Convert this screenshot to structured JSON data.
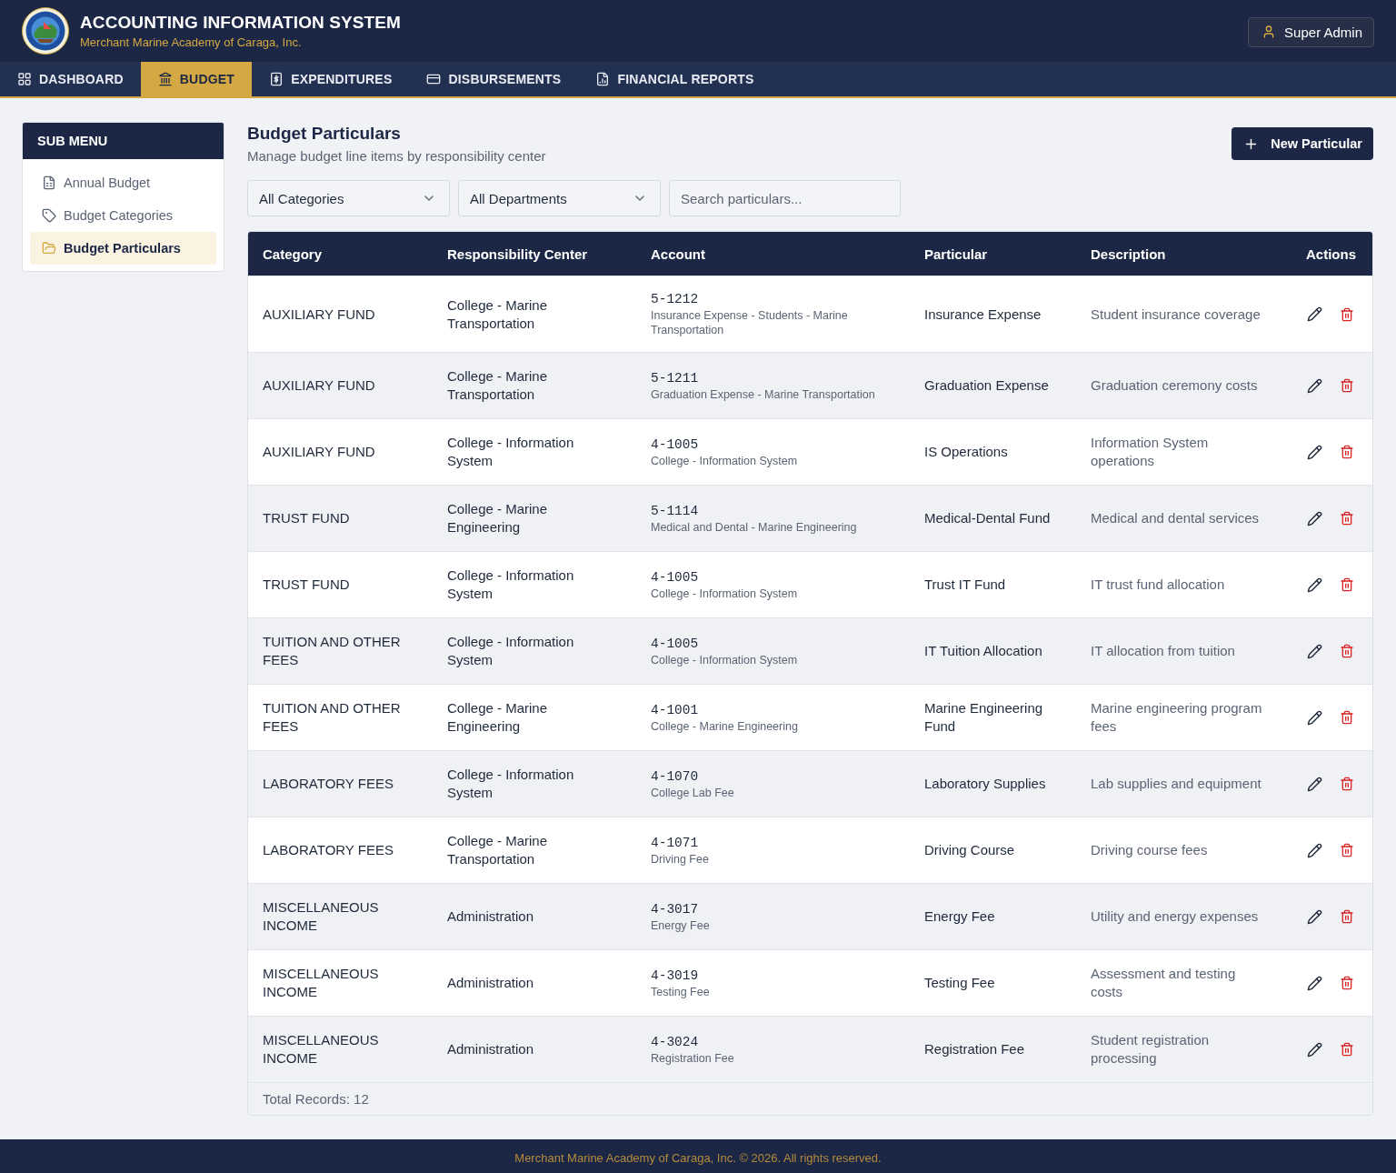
{
  "header": {
    "title": "ACCOUNTING INFORMATION SYSTEM",
    "subtitle": "Merchant Marine Academy of Caraga, Inc.",
    "user_button": "Super Admin"
  },
  "nav_tabs": [
    {
      "label": "DASHBOARD",
      "selected": false
    },
    {
      "label": "BUDGET",
      "selected": true
    },
    {
      "label": "EXPENDITURES",
      "selected": false
    },
    {
      "label": "DISBURSEMENTS",
      "selected": false
    },
    {
      "label": "FINANCIAL REPORTS",
      "selected": false
    }
  ],
  "sub_menu": {
    "title": "SUB MENU",
    "items": [
      {
        "label": "Annual Budget",
        "selected": false
      },
      {
        "label": "Budget Categories",
        "selected": false
      },
      {
        "label": "Budget Particulars",
        "selected": true
      }
    ]
  },
  "page": {
    "title": "Budget Particulars",
    "subtitle": "Manage budget line items by responsibility center",
    "new_button": "New Particular"
  },
  "filters": [
    {
      "kind": "select",
      "value": "All Categories"
    },
    {
      "kind": "select",
      "value": "All Departments"
    },
    {
      "kind": "search",
      "placeholder": "Search particulars..."
    }
  ],
  "table": {
    "columns": [
      "Category",
      "Responsibility Center",
      "Account",
      "Particular",
      "Description",
      "Actions"
    ],
    "rows": [
      {
        "category": "AUXILIARY FUND",
        "responsibility_center": "College - Marine Transportation",
        "account_code": "5-1212",
        "account_name": "Insurance Expense - Students - Marine Transportation",
        "particular": "Insurance Expense",
        "description": "Student insurance coverage"
      },
      {
        "category": "AUXILIARY FUND",
        "responsibility_center": "College - Marine Transportation",
        "account_code": "5-1211",
        "account_name": "Graduation Expense - Marine Transportation",
        "particular": "Graduation Expense",
        "description": "Graduation ceremony costs"
      },
      {
        "category": "AUXILIARY FUND",
        "responsibility_center": "College - Information System",
        "account_code": "4-1005",
        "account_name": "College - Information System",
        "particular": "IS Operations",
        "description": "Information System operations"
      },
      {
        "category": "TRUST FUND",
        "responsibility_center": "College - Marine Engineering",
        "account_code": "5-1114",
        "account_name": "Medical and Dental - Marine Engineering",
        "particular": "Medical-Dental Fund",
        "description": "Medical and dental services"
      },
      {
        "category": "TRUST FUND",
        "responsibility_center": "College - Information System",
        "account_code": "4-1005",
        "account_name": "College - Information System",
        "particular": "Trust IT Fund",
        "description": "IT trust fund allocation"
      },
      {
        "category": "TUITION AND OTHER FEES",
        "responsibility_center": "College - Information System",
        "account_code": "4-1005",
        "account_name": "College - Information System",
        "particular": "IT Tuition Allocation",
        "description": "IT allocation from tuition"
      },
      {
        "category": "TUITION AND OTHER FEES",
        "responsibility_center": "College - Marine Engineering",
        "account_code": "4-1001",
        "account_name": "College - Marine Engineering",
        "particular": "Marine Engineering Fund",
        "description": "Marine engineering program fees"
      },
      {
        "category": "LABORATORY FEES",
        "responsibility_center": "College - Information System",
        "account_code": "4-1070",
        "account_name": "College Lab Fee",
        "particular": "Laboratory Supplies",
        "description": "Lab supplies and equipment"
      },
      {
        "category": "LABORATORY FEES",
        "responsibility_center": "College - Marine Transportation",
        "account_code": "4-1071",
        "account_name": "Driving Fee",
        "particular": "Driving Course",
        "description": "Driving course fees"
      },
      {
        "category": "MISCELLANEOUS INCOME",
        "responsibility_center": "Administration",
        "account_code": "4-3017",
        "account_name": "Energy Fee",
        "particular": "Energy Fee",
        "description": "Utility and energy expenses"
      },
      {
        "category": "MISCELLANEOUS INCOME",
        "responsibility_center": "Administration",
        "account_code": "4-3019",
        "account_name": "Testing Fee",
        "particular": "Testing Fee",
        "description": "Assessment and testing costs"
      },
      {
        "category": "MISCELLANEOUS INCOME",
        "responsibility_center": "Administration",
        "account_code": "4-3024",
        "account_name": "Registration Fee",
        "particular": "Registration Fee",
        "description": "Student registration processing"
      }
    ],
    "total": "Total Records: 12"
  },
  "footer": "Merchant Marine Academy of Caraga, Inc. © 2026. All rights reserved."
}
